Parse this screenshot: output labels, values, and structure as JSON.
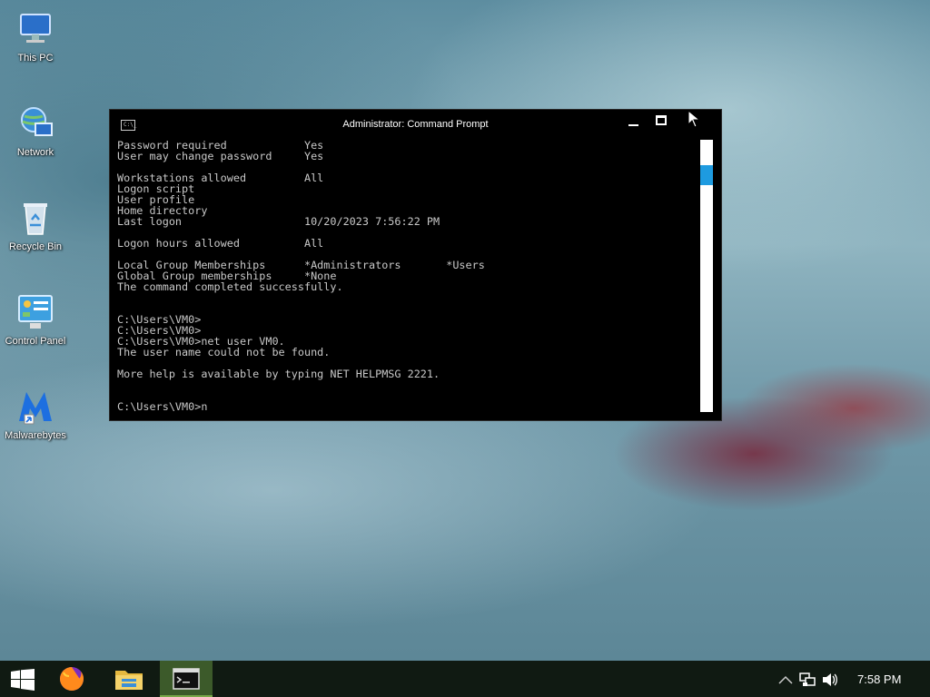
{
  "desktop": {
    "icons": [
      {
        "label": "This PC"
      },
      {
        "label": "Network"
      },
      {
        "label": "Recycle Bin"
      },
      {
        "label": "Control Panel"
      },
      {
        "label": "Malwarebytes"
      }
    ]
  },
  "window": {
    "title": "Administrator: Command Prompt",
    "icon_text": "C:\\_"
  },
  "console": {
    "lines": [
      "Password required            Yes",
      "User may change password     Yes",
      "",
      "Workstations allowed         All",
      "Logon script",
      "User profile",
      "Home directory",
      "Last logon                   10/20/2023 7:56:22 PM",
      "",
      "Logon hours allowed          All",
      "",
      "Local Group Memberships      *Administrators       *Users",
      "Global Group memberships     *None",
      "The command completed successfully.",
      "",
      "",
      "C:\\Users\\VM0>",
      "C:\\Users\\VM0>",
      "C:\\Users\\VM0>net user VM0.",
      "The user name could not be found.",
      "",
      "More help is available by typing NET HELPMSG 2221.",
      "",
      "",
      "C:\\Users\\VM0>n"
    ]
  },
  "scrollbar": {
    "thumb_color": "#1e9be0"
  },
  "taskbar": {
    "items": [
      "start-icon",
      "firefox-icon",
      "file-explorer-icon",
      "command-prompt-icon"
    ],
    "tray_icons": [
      "chevron-up-icon",
      "network-icon",
      "volume-icon"
    ],
    "clock": "7:58 PM"
  }
}
